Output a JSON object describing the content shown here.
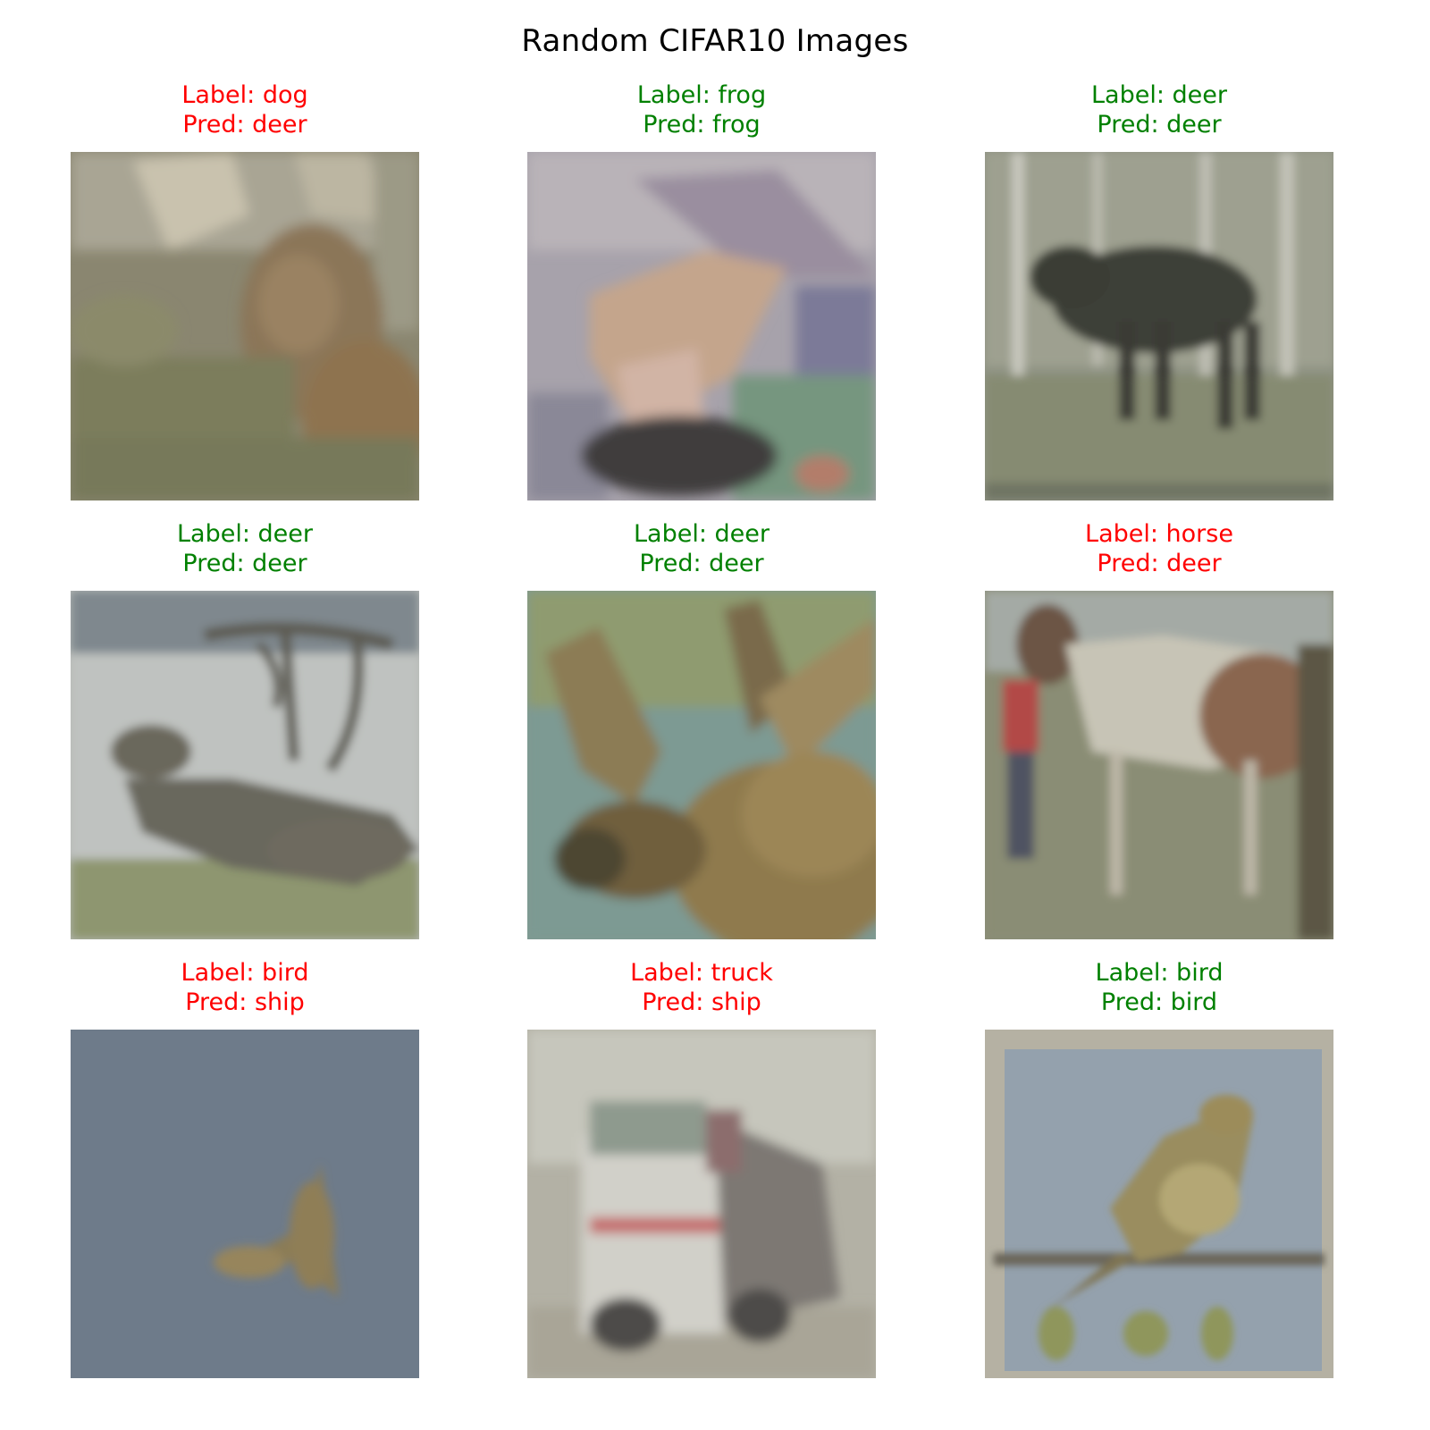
{
  "figure": {
    "title": "Random CIFAR10 Images",
    "colors": {
      "correct": "#008000",
      "incorrect": "#ff0000",
      "title": "#000000",
      "background": "#ffffff"
    }
  },
  "samples": [
    {
      "label_text": "Label: dog",
      "pred_text": "Pred: deer",
      "label": "dog",
      "pred": "deer",
      "correct": false,
      "subject": "dog in grass"
    },
    {
      "label_text": "Label: frog",
      "pred_text": "Pred: frog",
      "label": "frog",
      "pred": "frog",
      "correct": true,
      "subject": "frog on rock"
    },
    {
      "label_text": "Label: deer",
      "pred_text": "Pred: deer",
      "label": "deer",
      "pred": "deer",
      "correct": true,
      "subject": "moose in forest"
    },
    {
      "label_text": "Label: deer",
      "pred_text": "Pred: deer",
      "label": "deer",
      "pred": "deer",
      "correct": true,
      "subject": "reindeer lying down"
    },
    {
      "label_text": "Label: deer",
      "pred_text": "Pred: deer",
      "label": "deer",
      "pred": "deer",
      "correct": true,
      "subject": "moose head with antlers"
    },
    {
      "label_text": "Label: horse",
      "pred_text": "Pred: deer",
      "label": "horse",
      "pred": "deer",
      "correct": false,
      "subject": "pinto horse with person"
    },
    {
      "label_text": "Label: bird",
      "pred_text": "Pred: ship",
      "label": "bird",
      "pred": "ship",
      "correct": false,
      "subject": "small bird in blue sky"
    },
    {
      "label_text": "Label: truck",
      "pred_text": "Pred: ship",
      "label": "truck",
      "pred": "ship",
      "correct": false,
      "subject": "white truck"
    },
    {
      "label_text": "Label: bird",
      "pred_text": "Pred: bird",
      "label": "bird",
      "pred": "bird",
      "correct": true,
      "subject": "bird perched on branch"
    }
  ]
}
